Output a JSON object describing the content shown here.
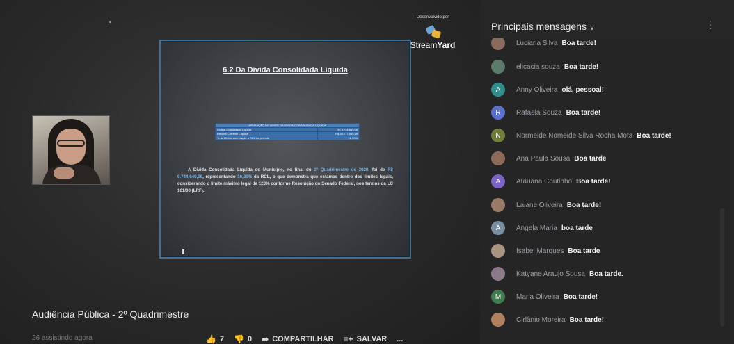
{
  "video": {
    "title": "Audiência Pública - 2º Quadrimestre",
    "viewers": "26 assistindo agora",
    "likes": "7",
    "dislikes": "0",
    "share_label": "COMPARTILHAR",
    "save_label": "SALVAR",
    "more": "..."
  },
  "branding": {
    "developed_by": "Desenvolvido por",
    "name_light": "Stream",
    "name_bold": "Yard"
  },
  "slide": {
    "title": "6.2 Da Dívida Consolidada Líquida",
    "table_header": "APURAÇÃO DO LIMITE DA DÍVIDA CONSOLIDADA LÍQUIDA",
    "table_rows": [
      {
        "label": "Dívida Consolidada Líquida",
        "value": "R$ 9.744.649,06"
      },
      {
        "label": "Receita Corrente Líquida",
        "value": "R$ 59.777.549,19"
      },
      {
        "label": "% da Dívida em relação à RCL no período",
        "value": "16,30%"
      }
    ],
    "text_parts": [
      {
        "t": "A Dívida Consolidada Líquida do Município, no final do ",
        "hl": false
      },
      {
        "t": "2º Quadrimestre de 2020",
        "hl": true
      },
      {
        "t": ", foi de ",
        "hl": false
      },
      {
        "t": "R$ 9.744.649,06",
        "hl": true
      },
      {
        "t": ", representando ",
        "hl": false
      },
      {
        "t": "16,30%",
        "hl": true
      },
      {
        "t": " da RCL, o que demonstra que estamos dentro dos limites legais, considerando o limite máximo legal de 120% conforme Resolução do Senado Federal, nos termos da LC 101/00 (LRF).",
        "hl": false
      }
    ]
  },
  "chat": {
    "title": "Principais mensagens",
    "messages": [
      {
        "author": "Luciana Silva",
        "text": "Boa tarde!",
        "initial": "",
        "color": "#8a6a5a"
      },
      {
        "author": "elicacia souza",
        "text": "Boa tarde!",
        "initial": "",
        "color": "#5c7a6a"
      },
      {
        "author": "Anny Oliveira",
        "text": "olá, pessoal!",
        "initial": "A",
        "color": "#2f8f8a"
      },
      {
        "author": "Rafaela Souza",
        "text": "Boa tarde!",
        "initial": "R",
        "color": "#5a6fd0"
      },
      {
        "author": "Normeide Nomeide Silva Rocha Mota",
        "text": "Boa tarde!",
        "initial": "N",
        "color": "#6f7d3a"
      },
      {
        "author": "Ana Paula Sousa",
        "text": "Boa tarde",
        "initial": "",
        "color": "#8d6b58"
      },
      {
        "author": "Atauana Coutinho",
        "text": "Boa tarde!",
        "initial": "A",
        "color": "#7b63c9"
      },
      {
        "author": "Laiane Oliveira",
        "text": "Boa tarde!",
        "initial": "",
        "color": "#9a7a68"
      },
      {
        "author": "Angela Maria",
        "text": "boa tarde",
        "initial": "A",
        "color": "#7a8da3"
      },
      {
        "author": "Isabel Marques",
        "text": "Boa tarde",
        "initial": "",
        "color": "#a89480"
      },
      {
        "author": "Katyane Araujo Sousa",
        "text": "Boa tarde.",
        "initial": "",
        "color": "#8c7a8a"
      },
      {
        "author": "Maria Oliveira",
        "text": "Boa tarde!",
        "initial": "M",
        "color": "#3f7d4f"
      },
      {
        "author": "Cirlânio Moreira",
        "text": "Boa tarde!",
        "initial": "",
        "color": "#b08060"
      }
    ]
  }
}
